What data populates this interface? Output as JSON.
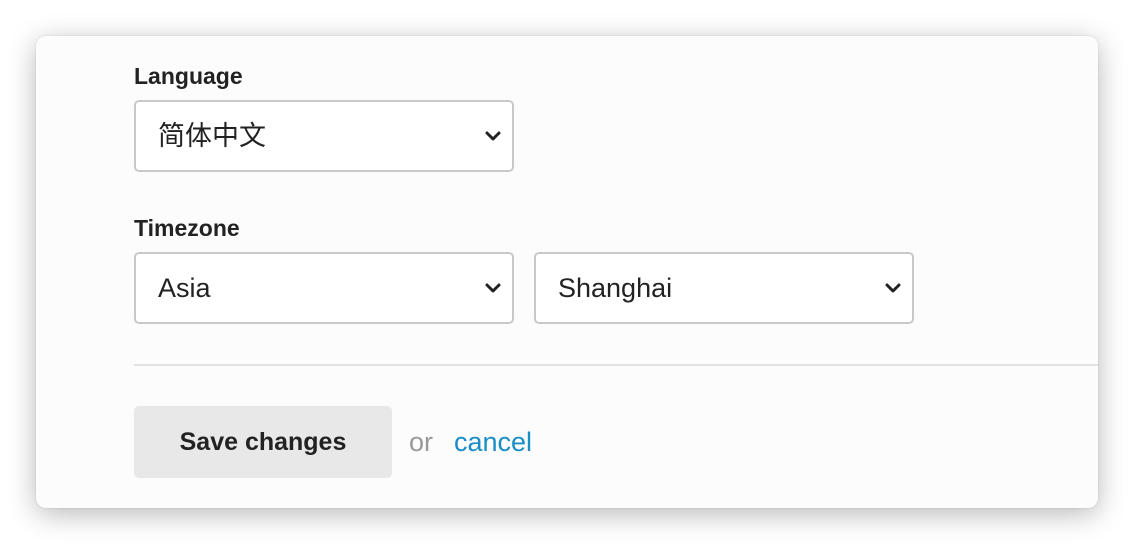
{
  "form": {
    "language": {
      "label": "Language",
      "selected": "简体中文"
    },
    "timezone": {
      "label": "Timezone",
      "region_selected": "Asia",
      "city_selected": "Shanghai"
    }
  },
  "actions": {
    "save_label": "Save changes",
    "or_text": "or",
    "cancel_label": "cancel"
  },
  "colors": {
    "link": "#1a8dc4",
    "button_bg": "#e8e8e8",
    "muted_text": "#999999"
  },
  "icons": {
    "select_chevron": "chevron-down-icon"
  }
}
